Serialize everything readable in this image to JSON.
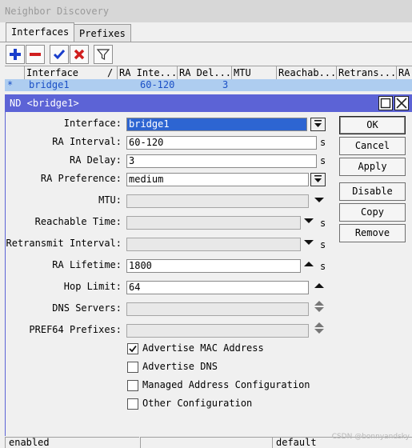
{
  "parent_window": {
    "title": "Neighbor Discovery"
  },
  "tabs": [
    {
      "label": "Interfaces",
      "active": true
    },
    {
      "label": "Prefixes",
      "active": false
    }
  ],
  "toolbar": {
    "buttons": [
      {
        "icon": "plus-icon",
        "color": "#1a3ecb"
      },
      {
        "icon": "minus-icon",
        "color": "#d01e1e"
      },
      {
        "icon": "check-icon",
        "color": "#1a3ecb"
      },
      {
        "icon": "cross-icon",
        "color": "#d01e1e"
      },
      {
        "icon": "filter-icon",
        "color": "#333333"
      }
    ]
  },
  "grid": {
    "columns": [
      "Interface",
      "RA Inte...",
      "RA Del...",
      "MTU",
      "Reachab...",
      "Retrans...",
      "RA"
    ],
    "rows": [
      {
        "marker": "*",
        "interface": "bridge1",
        "ra_interval": "60-120",
        "ra_delay": "3"
      }
    ]
  },
  "dialog": {
    "title": "ND <bridge1>",
    "fields": {
      "interface": {
        "label": "Interface:",
        "value": "bridge1"
      },
      "ra_interval": {
        "label": "RA Interval:",
        "value": "60-120",
        "unit": "s"
      },
      "ra_delay": {
        "label": "RA Delay:",
        "value": "3",
        "unit": "s"
      },
      "ra_preference": {
        "label": "RA Preference:",
        "value": "medium"
      },
      "mtu": {
        "label": "MTU:",
        "value": ""
      },
      "reachable_time": {
        "label": "Reachable Time:",
        "value": "",
        "unit": "s"
      },
      "retransmit_interval": {
        "label": "Retransmit Interval:",
        "value": "",
        "unit": "s"
      },
      "ra_lifetime": {
        "label": "RA Lifetime:",
        "value": "1800",
        "unit": "s"
      },
      "hop_limit": {
        "label": "Hop Limit:",
        "value": "64"
      },
      "dns_servers": {
        "label": "DNS Servers:",
        "value": ""
      },
      "pref64_prefixes": {
        "label": "PREF64 Prefixes:",
        "value": ""
      }
    },
    "checkboxes": [
      {
        "label": "Advertise MAC Address",
        "checked": true
      },
      {
        "label": "Advertise DNS",
        "checked": false
      },
      {
        "label": "Managed Address Configuration",
        "checked": false
      },
      {
        "label": "Other Configuration",
        "checked": false
      }
    ],
    "buttons": {
      "ok": "OK",
      "cancel": "Cancel",
      "apply": "Apply",
      "disable": "Disable",
      "copy": "Copy",
      "remove": "Remove"
    },
    "accent_color": "#5c63d6"
  },
  "statusbar": {
    "left": "enabled",
    "right": "default"
  },
  "watermark": "CSDN @bonnyandsky"
}
